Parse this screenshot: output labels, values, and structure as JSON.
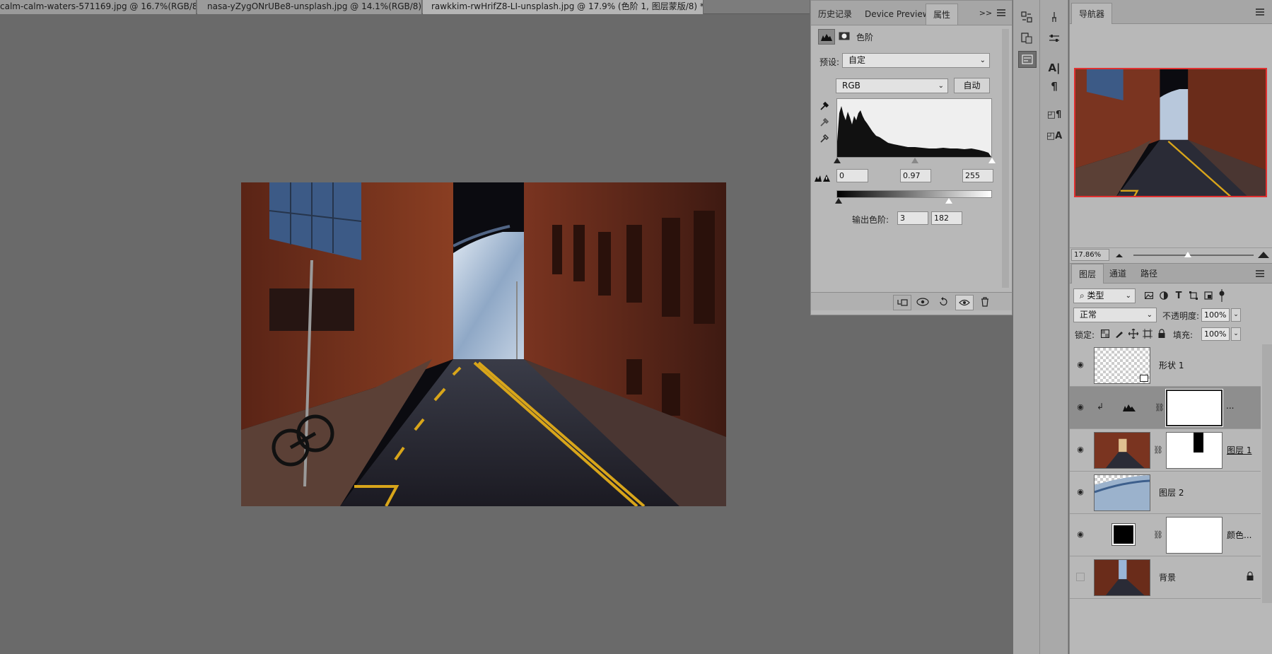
{
  "doc_tabs": [
    {
      "title": "calm-calm-waters-571169.jpg @ 16.7%(RGB/8) *",
      "close": "×"
    },
    {
      "title": "nasa-yZygONrUBe8-unsplash.jpg @ 14.1%(RGB/8) *",
      "close": "×"
    },
    {
      "title": "rawkkim-rwHrifZ8-LI-unsplash.jpg @ 17.9% (色阶 1, 图层蒙版/8) *",
      "close": "×"
    }
  ],
  "properties": {
    "tabs": [
      "历史记录",
      "Device Preview",
      "属性"
    ],
    "active_tab": "属性",
    "expand_icon": "double-chevron-right-icon",
    "menu_icon": "menu-icon",
    "title": "色阶",
    "preset_label": "预设:",
    "preset_value": "自定",
    "channel_value": "RGB",
    "auto_label": "自动",
    "input_black": "0",
    "input_gamma": "0.97",
    "input_white": "255",
    "output_label": "输出色阶:",
    "output_black": "3",
    "output_white": "182"
  },
  "navigator": {
    "tab": "导航器",
    "zoom": "17.86%",
    "zoom_slider_fraction": 0.45,
    "view_box_color": "#e03030"
  },
  "layers": {
    "tabs": [
      "图层",
      "通道",
      "路径"
    ],
    "active_tab": "图层",
    "filter_label": "类型",
    "blend_mode": "正常",
    "opacity_label": "不透明度:",
    "opacity": "100%",
    "lock_label": "锁定:",
    "fill_label": "填充:",
    "fill": "100%",
    "items": [
      {
        "name": "形状 1",
        "visible": true
      },
      {
        "name": "",
        "visible": true,
        "ellipsis": "..."
      },
      {
        "name": "图层 1",
        "visible": true
      },
      {
        "name": "图层 2",
        "visible": true
      },
      {
        "name": "颜色...",
        "visible": true
      },
      {
        "name": "背景",
        "visible": false
      }
    ]
  },
  "colors": {
    "workspace": "#6a6a6a",
    "panel": "#b8b8b8",
    "selected_row": "#8e8e8e"
  }
}
